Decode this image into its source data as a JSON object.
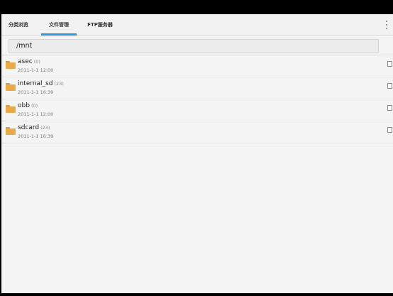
{
  "tabs": [
    {
      "label": "分类浏览",
      "active": false
    },
    {
      "label": "文件管理",
      "active": true
    },
    {
      "label": "FTP服务器",
      "active": false
    }
  ],
  "overflow_menu_icon": "vertical-dots-icon",
  "path": "/mnt",
  "files": [
    {
      "name": "asec",
      "count": "(0)",
      "date": "2011-1-1 12:00",
      "icon": "folder-icon",
      "checked": false
    },
    {
      "name": "internal_sd",
      "count": "(23)",
      "date": "2011-1-1 16:39",
      "icon": "folder-icon",
      "checked": false
    },
    {
      "name": "obb",
      "count": "(0)",
      "date": "2011-1-1 12:00",
      "icon": "folder-icon",
      "checked": false
    },
    {
      "name": "sdcard",
      "count": "(23)",
      "date": "2011-1-1 16:39",
      "icon": "folder-icon",
      "checked": false
    }
  ],
  "colors": {
    "accent": "#2c9bd6",
    "folder": "#e8a94b",
    "background": "#f4f4f4"
  }
}
